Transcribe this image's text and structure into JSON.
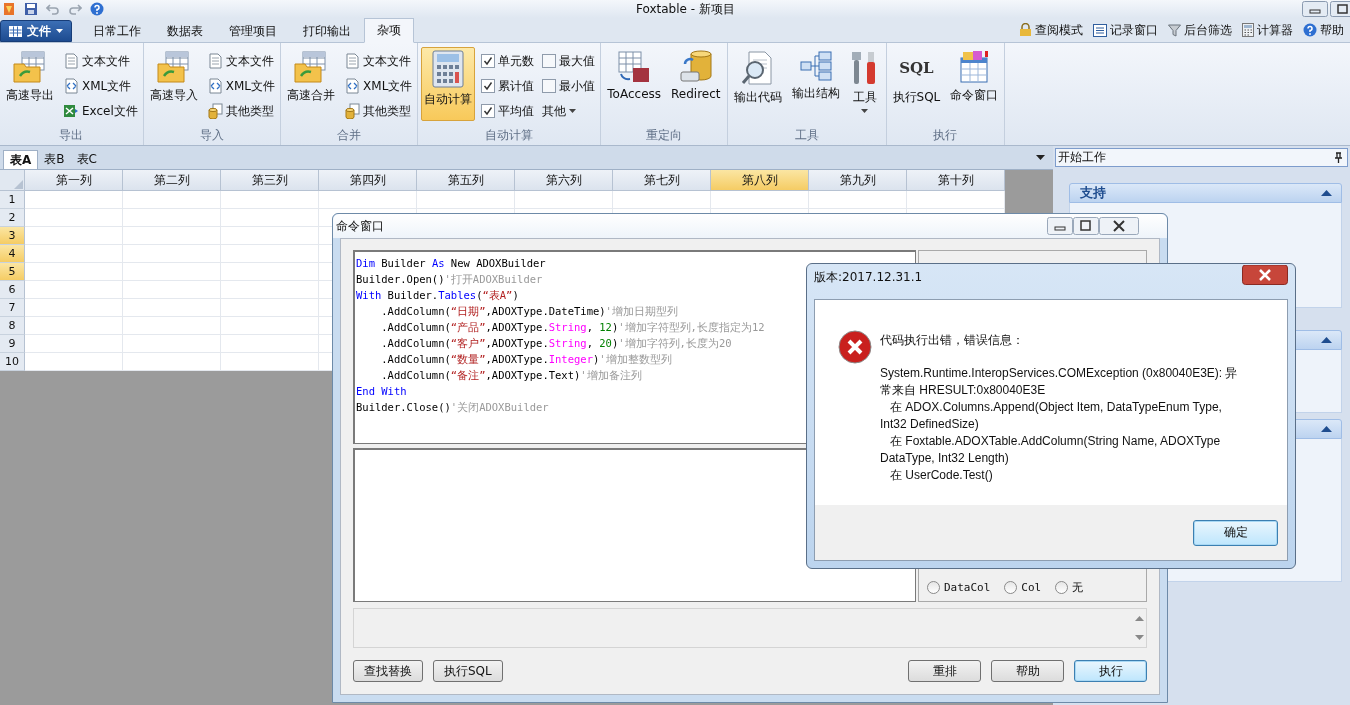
{
  "window": {
    "title": "Foxtable - 新项目"
  },
  "menu": {
    "file": "文件",
    "tabs": [
      {
        "label": "日常工作",
        "selected": false
      },
      {
        "label": "数据表",
        "selected": false
      },
      {
        "label": "管理项目",
        "selected": false
      },
      {
        "label": "打印输出",
        "selected": false
      },
      {
        "label": "杂项",
        "selected": true
      }
    ],
    "links": [
      "查阅模式",
      "记录窗口",
      "后台筛选",
      "计算器",
      "帮助"
    ]
  },
  "ribbon": {
    "groups": [
      {
        "label": "导出",
        "items": [
          {
            "kind": "large",
            "label": "高速导出",
            "on": false
          },
          {
            "kind": "small",
            "label": "文本文件"
          },
          {
            "kind": "small",
            "label": "XML文件"
          },
          {
            "kind": "small",
            "label": "Excel文件"
          }
        ]
      },
      {
        "label": "导入",
        "items": [
          {
            "kind": "large",
            "label": "高速导入",
            "on": false
          },
          {
            "kind": "small",
            "label": "文本文件"
          },
          {
            "kind": "small",
            "label": "XML文件"
          },
          {
            "kind": "small",
            "label": "其他类型"
          }
        ]
      },
      {
        "label": "合并",
        "items": [
          {
            "kind": "large",
            "label": "高速合并",
            "on": false
          },
          {
            "kind": "small",
            "label": "文本文件"
          },
          {
            "kind": "small",
            "label": "XML文件"
          },
          {
            "kind": "small",
            "label": "其他类型"
          }
        ]
      },
      {
        "label": "自动计算",
        "items": [
          {
            "kind": "large",
            "label": "自动计算",
            "on": true
          },
          {
            "kind": "check",
            "label": "单元数",
            "checked": true
          },
          {
            "kind": "check",
            "label": "累计值",
            "checked": true
          },
          {
            "kind": "check",
            "label": "平均值",
            "checked": true
          },
          {
            "kind": "check",
            "label": "最大值",
            "checked": false
          },
          {
            "kind": "check",
            "label": "最小值",
            "checked": false
          },
          {
            "kind": "menu",
            "label": "其他"
          }
        ]
      },
      {
        "label": "重定向",
        "items": [
          {
            "kind": "large",
            "label": "ToAccess",
            "on": false
          },
          {
            "kind": "large",
            "label": "Redirect",
            "on": false
          }
        ]
      },
      {
        "label": "工具",
        "items": [
          {
            "kind": "large",
            "label": "输出代码",
            "on": false
          },
          {
            "kind": "large",
            "label": "输出结构",
            "on": false
          },
          {
            "kind": "dropdown",
            "label": "工具"
          }
        ]
      },
      {
        "label": "执行",
        "items": [
          {
            "kind": "large",
            "label": "执行SQL",
            "on": false,
            "glyph": "SQL"
          },
          {
            "kind": "large",
            "label": "命令窗口",
            "on": false
          }
        ]
      }
    ]
  },
  "sheet_tabs": [
    {
      "label": "表A",
      "selected": true
    },
    {
      "label": "表B",
      "selected": false
    },
    {
      "label": "表C",
      "selected": false
    }
  ],
  "grid": {
    "columns": [
      {
        "label": "第一列",
        "selected": false
      },
      {
        "label": "第二列",
        "selected": false
      },
      {
        "label": "第三列",
        "selected": false
      },
      {
        "label": "第四列",
        "selected": false
      },
      {
        "label": "第五列",
        "selected": false
      },
      {
        "label": "第六列",
        "selected": false
      },
      {
        "label": "第七列",
        "selected": false
      },
      {
        "label": "第八列",
        "selected": true
      },
      {
        "label": "第九列",
        "selected": false
      },
      {
        "label": "第十列",
        "selected": false
      }
    ],
    "rows": [
      {
        "label": "1",
        "selected": false
      },
      {
        "label": "2",
        "selected": false
      },
      {
        "label": "3",
        "selected": true
      },
      {
        "label": "4",
        "selected": true
      },
      {
        "label": "5",
        "selected": true
      },
      {
        "label": "6",
        "selected": false
      },
      {
        "label": "7",
        "selected": false
      },
      {
        "label": "8",
        "selected": false
      },
      {
        "label": "9",
        "selected": false
      },
      {
        "label": "10",
        "selected": false
      }
    ]
  },
  "side_panel": {
    "title": "开始工作",
    "sections": [
      {
        "title": "支持",
        "expanded": true
      },
      {
        "expanded": true
      },
      {
        "expanded": true
      }
    ]
  },
  "command_window": {
    "title": "命令窗口",
    "code": [
      [
        {
          "kind": "keyword",
          "text": "Dim"
        },
        {
          "kind": "plain",
          "text": " Builder "
        },
        {
          "kind": "keyword",
          "text": "As"
        },
        {
          "kind": "plain",
          "text": " New ADOXBuilder"
        }
      ],
      [
        {
          "kind": "plain",
          "text": "Builder.Open()"
        },
        {
          "kind": "comment",
          "text": "'打开ADOXBuilder"
        }
      ],
      [
        {
          "kind": "keyword",
          "text": "With"
        },
        {
          "kind": "plain",
          "text": " Builder."
        },
        {
          "kind": "keyword",
          "text": "Tables"
        },
        {
          "kind": "plain",
          "text": "("
        },
        {
          "kind": "string",
          "text": "“表A”"
        },
        {
          "kind": "plain",
          "text": ")"
        }
      ],
      [
        {
          "kind": "plain",
          "text": "    .AddColumn("
        },
        {
          "kind": "string",
          "text": "“日期”"
        },
        {
          "kind": "plain",
          "text": ",ADOXType.DateTime)"
        },
        {
          "kind": "comment",
          "text": "'增加日期型列"
        }
      ],
      [
        {
          "kind": "plain",
          "text": "    .AddColumn("
        },
        {
          "kind": "string",
          "text": "“产品”"
        },
        {
          "kind": "plain",
          "text": ",ADOXType."
        },
        {
          "kind": "type",
          "text": "String"
        },
        {
          "kind": "plain",
          "text": ", "
        },
        {
          "kind": "number",
          "text": "12"
        },
        {
          "kind": "plain",
          "text": ")"
        },
        {
          "kind": "comment",
          "text": "'增加字符型列,长度指定为12"
        }
      ],
      [
        {
          "kind": "plain",
          "text": "    .AddColumn("
        },
        {
          "kind": "string",
          "text": "“客户”"
        },
        {
          "kind": "plain",
          "text": ",ADOXType."
        },
        {
          "kind": "type",
          "text": "String"
        },
        {
          "kind": "plain",
          "text": ", "
        },
        {
          "kind": "number",
          "text": "20"
        },
        {
          "kind": "plain",
          "text": ")"
        },
        {
          "kind": "comment",
          "text": "'增加字符列,长度为20"
        }
      ],
      [
        {
          "kind": "plain",
          "text": "    .AddColumn("
        },
        {
          "kind": "string",
          "text": "“数量”"
        },
        {
          "kind": "plain",
          "text": ",ADOXType."
        },
        {
          "kind": "type",
          "text": "Integer"
        },
        {
          "kind": "plain",
          "text": ")"
        },
        {
          "kind": "comment",
          "text": "'增加整数型列"
        }
      ],
      [
        {
          "kind": "plain",
          "text": "    .AddColumn("
        },
        {
          "kind": "string",
          "text": "“备注”"
        },
        {
          "kind": "plain",
          "text": ",ADOXType.Text)"
        },
        {
          "kind": "comment",
          "text": "'增加备注列"
        }
      ],
      [
        {
          "kind": "keyword",
          "text": "End With"
        }
      ],
      [
        {
          "kind": "plain",
          "text": "Builder.Close()"
        },
        {
          "kind": "comment",
          "text": "'关闭ADOXBuilder"
        }
      ]
    ],
    "options": [
      {
        "label": "DataCol",
        "selected": false
      },
      {
        "label": "Col",
        "selected": false
      },
      {
        "label": "无",
        "selected": false
      }
    ],
    "buttons_left": [
      "查找替换",
      "执行SQL"
    ],
    "buttons_right": [
      {
        "label": "重排",
        "default": false
      },
      {
        "label": "帮助",
        "default": false
      },
      {
        "label": "执行",
        "default": true
      }
    ]
  },
  "error_dialog": {
    "title": "版本:2017.12.31.1",
    "heading": "代码执行出错，错误信息：",
    "message": [
      "System.Runtime.InteropServices.COMException (0x80040E3E): 异",
      "常来自 HRESULT:0x80040E3E",
      "   在 ADOX.Columns.Append(Object Item, DataTypeEnum Type,",
      "Int32 DefinedSize)",
      "   在 Foxtable.ADOXTable.AddColumn(String Name, ADOXType",
      "DataType, Int32 Length)",
      "   在 UserCode.Test()"
    ],
    "button": "确定"
  }
}
